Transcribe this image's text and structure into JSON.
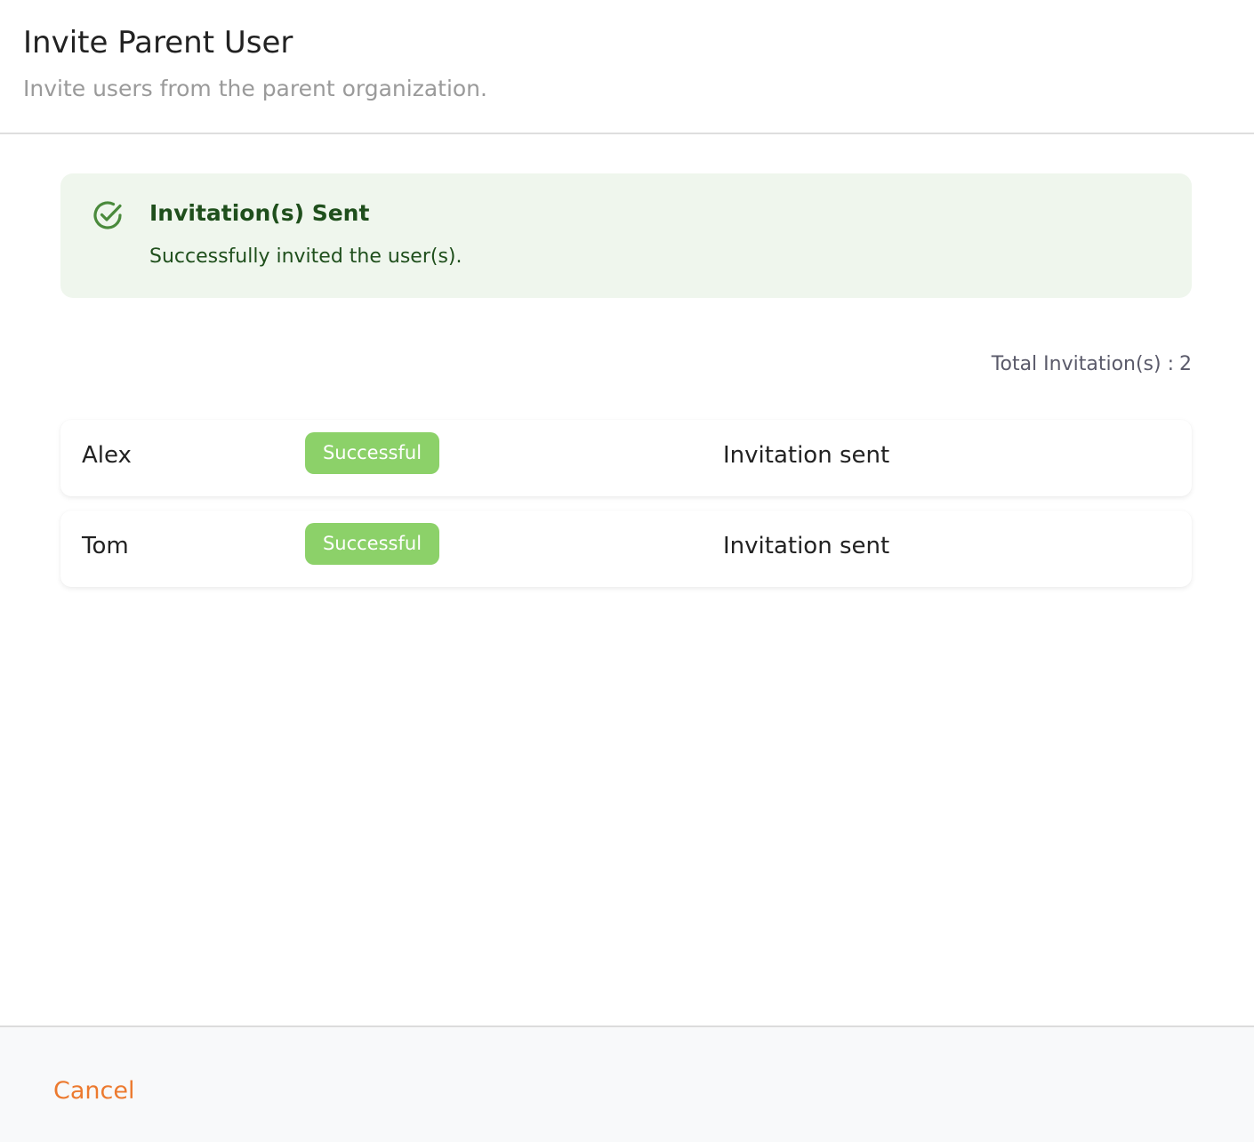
{
  "header": {
    "title": "Invite Parent User",
    "subtitle": "Invite users from the parent organization."
  },
  "alert": {
    "icon": "check-circle-icon",
    "title": "Invitation(s) Sent",
    "message": "Successfully invited the user(s).",
    "background_color": "#eff6ed",
    "text_color": "#1f4f1c",
    "icon_color": "#4a8a3c"
  },
  "summary": {
    "total_label": "Total Invitation(s) :",
    "total_count": "2"
  },
  "invitations": [
    {
      "name": "Alex",
      "status": "Successful",
      "message": "Invitation sent"
    },
    {
      "name": "Tom",
      "status": "Successful",
      "message": "Invitation sent"
    }
  ],
  "status_color": "#8cd169",
  "footer": {
    "cancel_label": "Cancel",
    "cancel_color": "#ec7a2f"
  }
}
